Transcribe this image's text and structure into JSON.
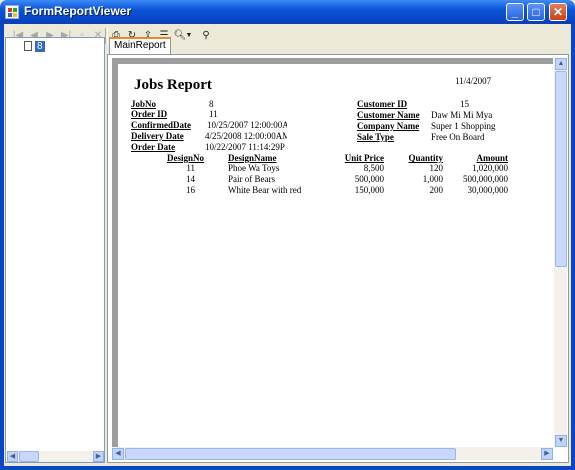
{
  "window": {
    "title": "FormReportViewer"
  },
  "toolbar": {
    "icons": [
      "first-page-icon",
      "previous-page-icon",
      "next-page-icon",
      "last-page-icon",
      "goto-page-icon",
      "stop-icon",
      "print-icon",
      "refresh-icon",
      "export-icon",
      "group-tree-icon",
      "zoom-icon",
      "search-icon"
    ]
  },
  "tree": {
    "node_label": "8"
  },
  "tabs": {
    "main": "MainReport"
  },
  "report": {
    "title": "Jobs Report",
    "date": "11/4/2007",
    "fields_left": [
      {
        "label": "JobNo",
        "value": "8"
      },
      {
        "label": "Order ID",
        "value": "11"
      },
      {
        "label": "ConfirmedDate",
        "value": "10/25/2007  12:00:00A"
      },
      {
        "label": "Delivery Date",
        "value": "4/25/2008  12:00:00AM"
      },
      {
        "label": "Order Date",
        "value": "10/22/2007  11:14:29P"
      }
    ],
    "fields_right": [
      {
        "label": "Customer ID",
        "value": "15"
      },
      {
        "label": "Customer Name",
        "value": "Daw Mi Mi Mya"
      },
      {
        "label": "Company Name",
        "value": "Super 1 Shopping"
      },
      {
        "label": "Sale Type",
        "value": "Free On Board"
      }
    ],
    "columns": [
      "DesignNo",
      "DesignName",
      "Unit Price",
      "Quantity",
      "Amount"
    ],
    "rows": [
      [
        "11",
        "Phoe Wa Toys",
        "8,500",
        "120",
        "1,020,000"
      ],
      [
        "14",
        "Pair of Bears",
        "500,000",
        "1,000",
        "500,000,000"
      ],
      [
        "16",
        "White Bear with red",
        "150,000",
        "200",
        "30,000,000"
      ]
    ]
  }
}
